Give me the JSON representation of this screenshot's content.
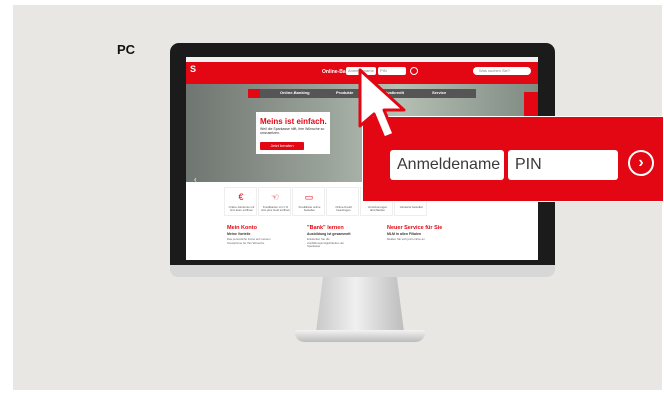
{
  "label": "PC",
  "site": {
    "logo": "S",
    "header_text": "Online-Ba",
    "mini_login_name": "Anmeldename",
    "mini_login_pin": "PIN",
    "search_placeholder": "Was suchen Sie?",
    "nav": [
      "Online-Banking",
      "Produkte",
      "Privatkredit",
      "Service"
    ],
    "hero": {
      "title": "Meins ist einfach.",
      "subtitle": "Weil die Sparkasse hilft, ihre Wünsche so umzusetzen.",
      "button": "Jetzt beraten"
    },
    "tiles": [
      {
        "icon": "€",
        "text": "Online-Girokonto mit Giro Euro eröffnen"
      },
      {
        "icon": "☜",
        "text": "Kreditkarten mit 1 % Giro plus Geld eröffnen"
      },
      {
        "icon": "▭",
        "text": "Kreditkarte online bestellen"
      },
      {
        "icon": "",
        "text": "Online-Kredit beantragen"
      },
      {
        "icon": "",
        "text": "Versicherungen abschließen"
      },
      {
        "icon": "",
        "text": "Girokarte bestellen"
      }
    ],
    "cards": [
      {
        "title": "Mein Konto",
        "subtitle": "Meine Vorteile",
        "body": "Das persönliche Konto auf meinem Smartphone für Ihre Wünsche"
      },
      {
        "title": "\"Bank\" lernen",
        "subtitle": "Ausbildung ist gesammelt",
        "body": "Entdecken Sie die Ausbildungsmöglichkeiten der Sparkasse"
      },
      {
        "title": "Neuer Service für Sie",
        "subtitle": "MLM in allen Filialen",
        "body": "Melden Sie sich jetzt online an"
      }
    ]
  },
  "zoom": {
    "username_placeholder": "Anmeldename",
    "pin_placeholder": "PIN",
    "submit_icon": "chevron-right-icon"
  },
  "colors": {
    "brand": "#e30613",
    "nav": "#555555",
    "bezel": "#1b1b1b"
  }
}
